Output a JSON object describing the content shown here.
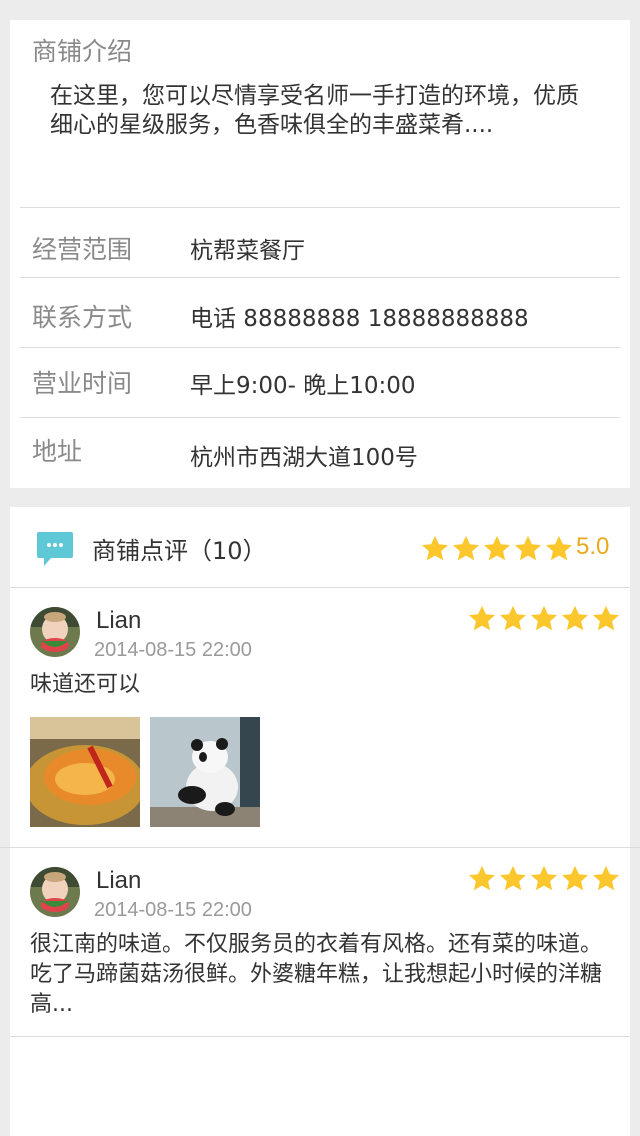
{
  "shop_intro": {
    "title": "商铺介绍",
    "body": "在这里，您可以尽情享受名师一手打造的环境，优质细心的星级服务，色香味俱全的丰盛菜肴...."
  },
  "info": [
    {
      "label": "经营范围",
      "value": "杭帮菜餐厅"
    },
    {
      "label": "联系方式",
      "value": "电话  88888888  18888888888"
    },
    {
      "label": "营业时间",
      "value": "早上9:00- 晚上10:00"
    },
    {
      "label": "地址",
      "value": "杭州市西湖大道100号"
    }
  ],
  "reviews_section": {
    "title": "商铺点评（10）",
    "rating": 5,
    "score": "5.0",
    "icon": "comment-bubble-icon",
    "accent_color": "#5fc8d6",
    "star_color": "#fbc72c"
  },
  "reviews": [
    {
      "user": "Lian",
      "date": "2014-08-15 22:00",
      "rating": 5,
      "text": "味道还可以",
      "photos": [
        "food-photo",
        "panda-photo"
      ]
    },
    {
      "user": "Lian",
      "date": "2014-08-15 22:00",
      "rating": 5,
      "text": "很江南的味道。不仅服务员的衣着有风格。还有菜的味道。吃了马蹄菌菇汤很鲜。外婆糖年糕，让我想起小时候的洋糖高..."
    }
  ]
}
